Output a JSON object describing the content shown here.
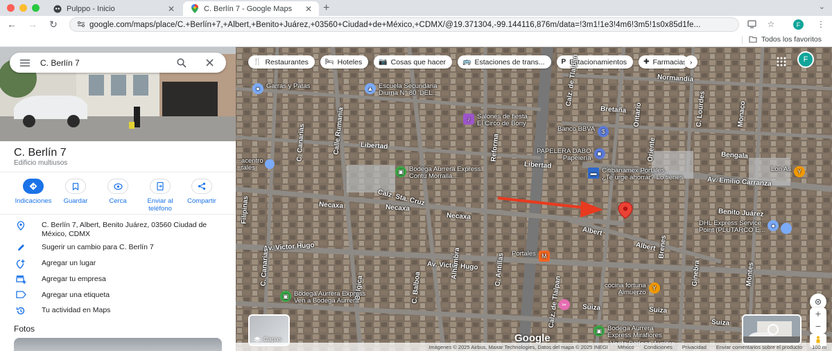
{
  "browser": {
    "tabs": [
      {
        "title": "Pulppo - Inicio",
        "active": false
      },
      {
        "title": "C. Berlín 7 - Google Maps",
        "active": true
      }
    ],
    "url": "google.com/maps/place/C.+Berlín+7,+Albert,+Benito+Juárez,+03560+Ciudad+de+México,+CDMX/@19.371304,-99.144116,876m/data=!3m1!1e3!4m6!3m5!1s0x85d1fe...",
    "profile_initial": "F",
    "bookmarks_all": "Todos los favoritos"
  },
  "search": {
    "value": "C. Berlín 7"
  },
  "place": {
    "title": "C. Berlín 7",
    "subtitle": "Edificio multiusos",
    "actions": [
      {
        "label": "Indicaciones",
        "icon": "directions-icon"
      },
      {
        "label": "Guardar",
        "icon": "bookmark-icon"
      },
      {
        "label": "Cerca",
        "icon": "nearby-icon"
      },
      {
        "label": "Enviar al teléfono",
        "icon": "send-to-phone-icon"
      },
      {
        "label": "Compartir",
        "icon": "share-icon"
      }
    ],
    "address": "C. Berlín 7, Albert, Benito Juárez, 03560 Ciudad de México, CDMX",
    "suggest_edit": "Sugerir un cambio para C. Berlín 7",
    "add_place": "Agregar un lugar",
    "add_business": "Agregar tu empresa",
    "add_label": "Agregar una etiqueta",
    "activity": "Tu actividad en Maps",
    "photos_title": "Fotos"
  },
  "map": {
    "chips": [
      {
        "label": "Restaurantes",
        "icon": "restaurant-icon"
      },
      {
        "label": "Hoteles",
        "icon": "hotel-icon"
      },
      {
        "label": "Cosas que hacer",
        "icon": "camera-icon"
      },
      {
        "label": "Estaciones de trans...",
        "icon": "transit-icon"
      },
      {
        "label": "Estacionamientos",
        "icon": "parking-icon"
      },
      {
        "label": "Farmacias",
        "icon": "pharmacy-icon"
      }
    ],
    "streets": [
      {
        "name": "Normandía"
      },
      {
        "name": "Bretaña"
      },
      {
        "name": "Libertad"
      },
      {
        "name": "Libertad"
      },
      {
        "name": "Calz. Sta. Cruz"
      },
      {
        "name": "Necaxa"
      },
      {
        "name": "Necaxa"
      },
      {
        "name": "Necaxa"
      },
      {
        "name": "Av. Victor Hugo"
      },
      {
        "name": "Av. Victor Hugo"
      },
      {
        "name": "Albert"
      },
      {
        "name": "Albert"
      },
      {
        "name": "Benito Juárez"
      },
      {
        "name": "Bengala"
      },
      {
        "name": "Av. Emilio Carranza"
      },
      {
        "name": "Suiza"
      },
      {
        "name": "Suiza"
      },
      {
        "name": "Suiza"
      },
      {
        "name": "Calz. de Tlalpan"
      },
      {
        "name": "Calz. de Tlalpan"
      },
      {
        "name": "Calle Rumania"
      },
      {
        "name": "C. Balboa"
      },
      {
        "name": "Alhambra"
      },
      {
        "name": "C. Antillas"
      },
      {
        "name": "Reforma"
      },
      {
        "name": "Filipinas"
      },
      {
        "name": "C. Canarias"
      },
      {
        "name": "Bélgica"
      },
      {
        "name": "C. Canarias"
      },
      {
        "name": "Ontario"
      },
      {
        "name": "Oriente"
      },
      {
        "name": "C. Lourdes"
      },
      {
        "name": "Monaco"
      },
      {
        "name": "Brenes"
      },
      {
        "name": "Ginebra"
      },
      {
        "name": "Montes"
      }
    ],
    "pois": [
      {
        "name": "Garras y Patas",
        "sub": ""
      },
      {
        "name": "Escuela Secundaria",
        "sub": "Diurna N° 80 'DEL..."
      },
      {
        "name": "Salones de fiesta",
        "sub": "El Circo de Bony"
      },
      {
        "name": "Banco BBVA",
        "sub": ""
      },
      {
        "name": "PAPELERA DABO",
        "sub": "Papelería"
      },
      {
        "name": "Bodega Aurrera Express",
        "sub": "Contu Morralla..."
      },
      {
        "name": "Citibanamex Portales",
        "sub": "¿Te urge ahorrar? Lo tienes"
      },
      {
        "name": "Lori As",
        "sub": ""
      },
      {
        "name": "DHL Express Service",
        "sub": "Point (PLUTARCO E..."
      },
      {
        "name": "Portales",
        "sub": ""
      },
      {
        "name": "cocina fortuna",
        "sub": "Almuerzo"
      },
      {
        "name": "Bodega Aurrera Express",
        "sub": "Ven a Bodega Aurrera"
      },
      {
        "name": "Bodega Aurrera",
        "sub": "Express Miraflores"
      },
      {
        "name": "Venta Bodega Aurrera",
        "sub": ""
      },
      {
        "name": "...acentro",
        "sub": "...tales"
      }
    ],
    "layers_label": "Capas",
    "google_logo": "Google",
    "footer": [
      "Imágenes © 2025 Airbus, Maxar Technologies, Datos del mapa © 2025 INEGI",
      "México",
      "Condiciones",
      "Privacidad",
      "Enviar comentarios sobre el producto",
      "100 m"
    ]
  }
}
